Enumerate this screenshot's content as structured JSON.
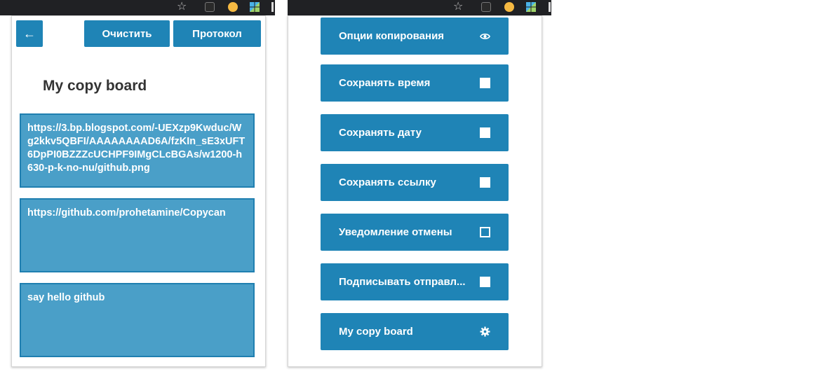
{
  "browser": {
    "left_star": "☆",
    "right_star": "☆"
  },
  "left_panel": {
    "back_icon": "←",
    "clear_label": "Очистить",
    "log_label": "Протокол",
    "board_title": "My copy board",
    "clips": [
      "https://3.bp.blogspot.com/-UEXzp9Kwduc/Wg2kkv5QBFI/AAAAAAAAD6A/fzKIn_sE3xUFT6DpPI0BZZZcUCHPF9IMgCLcBGAs/w1200-h630-p-k-no-nu/github.png",
      "https://github.com/prohetamine/Copycan",
      "say hello github"
    ]
  },
  "right_panel": {
    "options": [
      {
        "label": "Опции копирования",
        "icon": "eye-icon",
        "glyph": "👁"
      },
      {
        "label": "Сохранять время",
        "icon": "checkbox-checked"
      },
      {
        "label": "Сохранять дату",
        "icon": "checkbox-checked"
      },
      {
        "label": "Сохранять ссылку",
        "icon": "checkbox-checked"
      },
      {
        "label": "Уведомление отмены",
        "icon": "checkbox-unchecked"
      },
      {
        "label": "Подписывать отправл...",
        "icon": "checkbox-checked"
      },
      {
        "label": "My copy board",
        "icon": "gear-icon",
        "glyph": "⚙"
      }
    ]
  },
  "colors": {
    "primary": "#1f84b6",
    "card": "#4a9fc8",
    "card_border": "#1f7fb0",
    "title": "#333333"
  }
}
